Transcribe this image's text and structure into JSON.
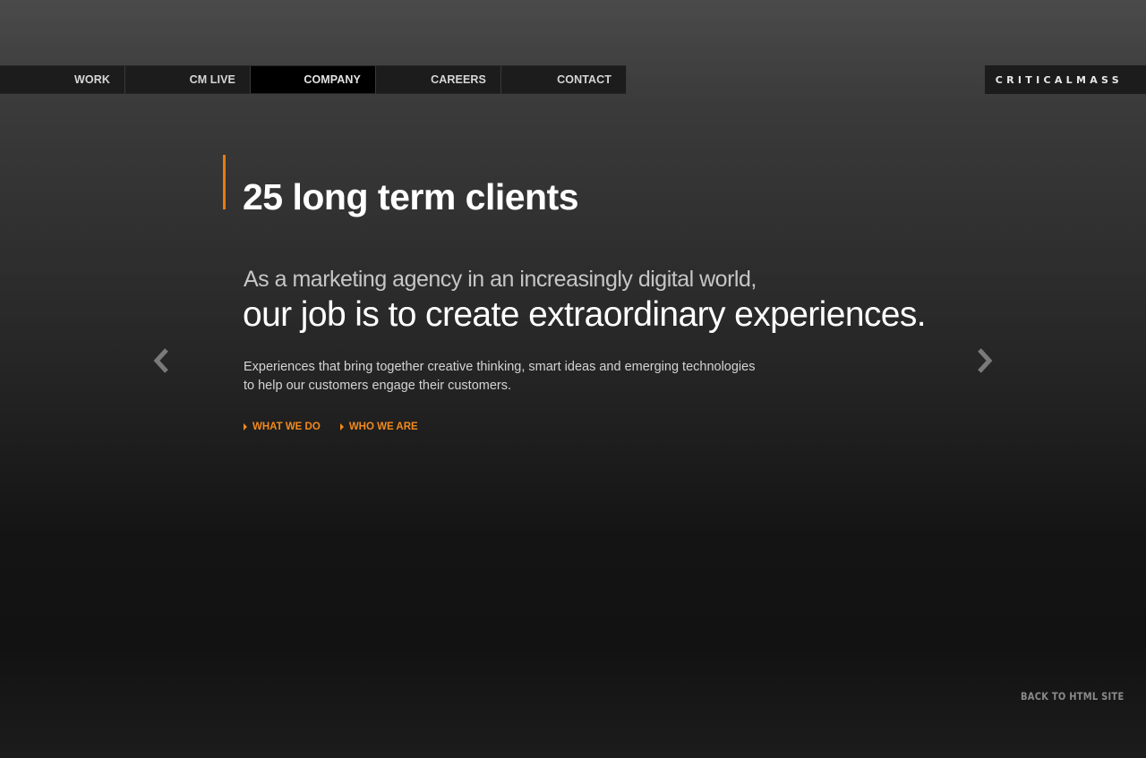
{
  "nav": {
    "items": [
      {
        "label": "WORK"
      },
      {
        "label": "CM LIVE"
      },
      {
        "label": "COMPANY"
      },
      {
        "label": "CAREERS"
      },
      {
        "label": "CONTACT"
      }
    ],
    "active": "COMPANY"
  },
  "logo": {
    "text": "CRITICALMASS"
  },
  "main": {
    "headline": "25 long term clients",
    "intro_small": "As a marketing agency in an increasingly digital world,",
    "intro_large": "our job is to create extraordinary experiences.",
    "body_line1": "Experiences that bring together creative thinking, smart ideas and emerging technologies",
    "body_line2": "to help our customers engage their customers.",
    "links": [
      {
        "label": "WHAT WE DO"
      },
      {
        "label": "WHO WE ARE"
      }
    ]
  },
  "arrows": {
    "prev_icon": "chevron-left-icon",
    "next_icon": "chevron-right-icon"
  },
  "footer": {
    "back_link": "BACK TO HTML SITE"
  },
  "colors": {
    "accent": "#e87b10",
    "link": "#f28a1e",
    "nav_bg": "#1c1c1c",
    "nav_active_bg": "#000000"
  }
}
